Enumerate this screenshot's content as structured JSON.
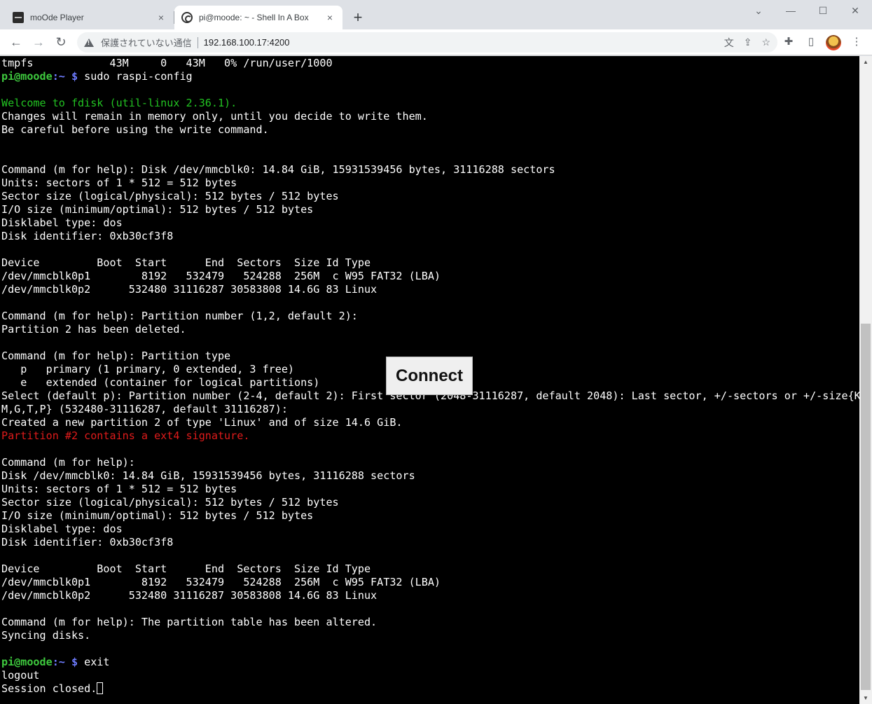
{
  "browser": {
    "tabs": [
      {
        "title": "moOde Player",
        "active": false
      },
      {
        "title": "pi@moode: ~ - Shell In A Box",
        "active": true
      }
    ],
    "tab_close_glyph": "×",
    "new_tab_glyph": "+",
    "window_controls": {
      "chevron": "⌄",
      "minimize": "—",
      "maximize": "☐",
      "close": "✕"
    },
    "nav": {
      "back": "←",
      "forward": "→",
      "reload": "↻"
    },
    "address": {
      "security_label": "保護されていない通信",
      "url": "192.168.100.17:4200"
    },
    "icons": {
      "translate": "文",
      "share": "⇪",
      "bookmark": "☆",
      "extensions": "✚",
      "sidepanel": "▯",
      "menu": "⋮"
    },
    "colors": {
      "tabstrip": "#dee1e6",
      "toolbar": "#ffffff",
      "terminal_bg": "#000000"
    }
  },
  "terminal": {
    "prompt_user": "pi@moode",
    "prompt_path": "~",
    "prompt_symbol": "$",
    "lines": [
      {
        "text": "tmpfs            43M     0   43M   0% /run/user/1000"
      },
      {
        "prompt": true,
        "text": " sudo raspi-config"
      },
      {
        "text": ""
      },
      {
        "text": "Welcome to fdisk (util-linux 2.36.1).",
        "color": "green"
      },
      {
        "text": "Changes will remain in memory only, until you decide to write them."
      },
      {
        "text": "Be careful before using the write command."
      },
      {
        "text": ""
      },
      {
        "text": ""
      },
      {
        "text": "Command (m for help): Disk /dev/mmcblk0: 14.84 GiB, 15931539456 bytes, 31116288 sectors"
      },
      {
        "text": "Units: sectors of 1 * 512 = 512 bytes"
      },
      {
        "text": "Sector size (logical/physical): 512 bytes / 512 bytes"
      },
      {
        "text": "I/O size (minimum/optimal): 512 bytes / 512 bytes"
      },
      {
        "text": "Disklabel type: dos"
      },
      {
        "text": "Disk identifier: 0xb30cf3f8"
      },
      {
        "text": ""
      },
      {
        "text": "Device         Boot  Start      End  Sectors  Size Id Type"
      },
      {
        "text": "/dev/mmcblk0p1        8192   532479   524288  256M  c W95 FAT32 (LBA)"
      },
      {
        "text": "/dev/mmcblk0p2      532480 31116287 30583808 14.6G 83 Linux"
      },
      {
        "text": ""
      },
      {
        "text": "Command (m for help): Partition number (1,2, default 2):"
      },
      {
        "text": "Partition 2 has been deleted."
      },
      {
        "text": ""
      },
      {
        "text": "Command (m for help): Partition type"
      },
      {
        "text": "   p   primary (1 primary, 0 extended, 3 free)"
      },
      {
        "text": "   e   extended (container for logical partitions)"
      },
      {
        "text": "Select (default p): Partition number (2-4, default 2): First sector (2048-31116287, default 2048): Last sector, +/-sectors or +/-size{K,"
      },
      {
        "text": "M,G,T,P} (532480-31116287, default 31116287):"
      },
      {
        "text": "Created a new partition 2 of type 'Linux' and of size 14.6 GiB."
      },
      {
        "text": "Partition #2 contains a ext4 signature.",
        "color": "red"
      },
      {
        "text": ""
      },
      {
        "text": "Command (m for help):"
      },
      {
        "text": "Disk /dev/mmcblk0: 14.84 GiB, 15931539456 bytes, 31116288 sectors"
      },
      {
        "text": "Units: sectors of 1 * 512 = 512 bytes"
      },
      {
        "text": "Sector size (logical/physical): 512 bytes / 512 bytes"
      },
      {
        "text": "I/O size (minimum/optimal): 512 bytes / 512 bytes"
      },
      {
        "text": "Disklabel type: dos"
      },
      {
        "text": "Disk identifier: 0xb30cf3f8"
      },
      {
        "text": ""
      },
      {
        "text": "Device         Boot  Start      End  Sectors  Size Id Type"
      },
      {
        "text": "/dev/mmcblk0p1        8192   532479   524288  256M  c W95 FAT32 (LBA)"
      },
      {
        "text": "/dev/mmcblk0p2      532480 31116287 30583808 14.6G 83 Linux"
      },
      {
        "text": ""
      },
      {
        "text": "Command (m for help): The partition table has been altered."
      },
      {
        "text": "Syncing disks."
      },
      {
        "text": ""
      },
      {
        "prompt": true,
        "text": " exit"
      },
      {
        "text": "logout"
      },
      {
        "text": "Session closed.",
        "cursor": true
      }
    ]
  },
  "connect_button": {
    "label": "Connect"
  },
  "scrollbar": {
    "up": "▲",
    "down": "▼"
  }
}
